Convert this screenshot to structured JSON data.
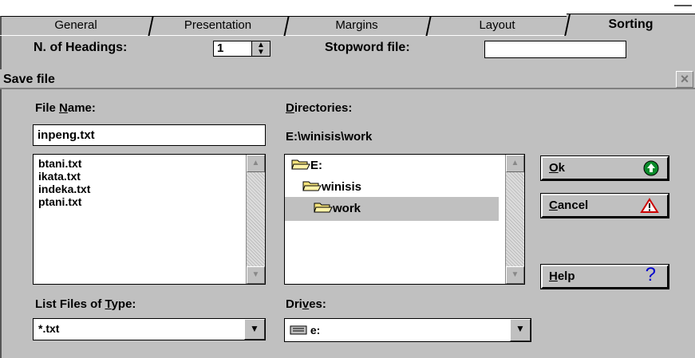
{
  "tabs": [
    {
      "label": "General"
    },
    {
      "label": "Presentation"
    },
    {
      "label": "Margins"
    },
    {
      "label": "Layout"
    },
    {
      "label": "Sorting",
      "active": true
    }
  ],
  "headings": {
    "label": "N. of Headings:",
    "value": "1",
    "stopword_label": "Stopword file:",
    "stopword_value": ""
  },
  "dialog": {
    "title": "Save file",
    "file_name_label_pre": "File ",
    "file_name_label_acc": "N",
    "file_name_label_post": "ame:",
    "file_name_value": "inpeng.txt",
    "files": [
      "btani.txt",
      "ikata.txt",
      "indeka.txt",
      "ptani.txt"
    ],
    "directories_label_acc": "D",
    "directories_label_post": "irectories:",
    "current_dir": "E:\\winisis\\work",
    "dirs": [
      "E:",
      "winisis",
      "work"
    ],
    "type_label_pre": "List Files of ",
    "type_label_acc": "T",
    "type_label_post": "ype:",
    "type_value": "*.txt",
    "drives_label_pre": "Dri",
    "drives_label_acc": "v",
    "drives_label_post": "es:",
    "drive_value": "e:",
    "ok_acc": "O",
    "ok_post": "k",
    "cancel_acc": "C",
    "cancel_post": "ancel",
    "help_acc": "H",
    "help_post": "elp"
  },
  "icons": {
    "ok": "green-up-arrow-icon",
    "cancel": "warning-triangle-icon",
    "help": "question-mark-icon",
    "folder": "folder-icon",
    "drive": "drive-icon",
    "close": "close-icon"
  },
  "colors": {
    "face": "#c0c0c0",
    "ok_icon": "#0a8a2a",
    "warning": "#cc0000",
    "help": "#0000cc"
  }
}
